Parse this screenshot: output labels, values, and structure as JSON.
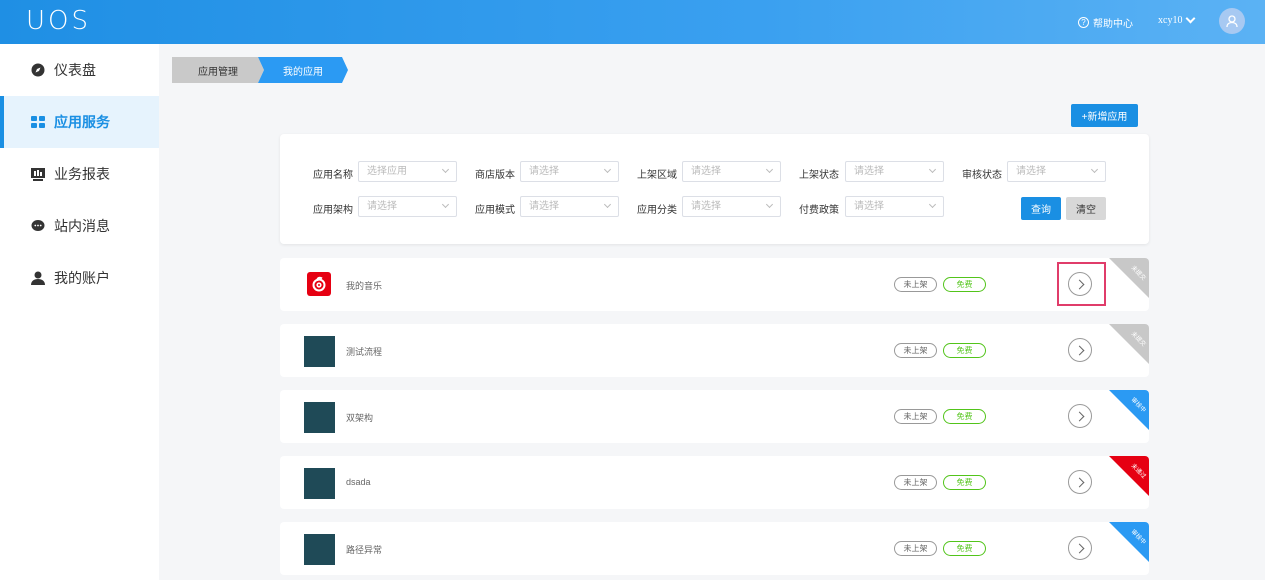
{
  "header": {
    "logo": "UOS",
    "help_label": "帮助中心",
    "username": "xcy10"
  },
  "sidebar": {
    "items": [
      {
        "label": "仪表盘",
        "icon": "compass-icon",
        "active": false
      },
      {
        "label": "应用服务",
        "icon": "grid-icon",
        "active": true
      },
      {
        "label": "业务报表",
        "icon": "report-icon",
        "active": false
      },
      {
        "label": "站内消息",
        "icon": "message-icon",
        "active": false
      },
      {
        "label": "我的账户",
        "icon": "user-icon",
        "active": false
      }
    ]
  },
  "breadcrumb": [
    "应用管理",
    "我的应用"
  ],
  "actions": {
    "add_app": "+新增应用"
  },
  "filters": {
    "app_name": {
      "label": "应用名称",
      "placeholder": "选择应用"
    },
    "store_version": {
      "label": "商店版本",
      "placeholder": "请选择"
    },
    "shelf_region": {
      "label": "上架区域",
      "placeholder": "请选择"
    },
    "shelf_status": {
      "label": "上架状态",
      "placeholder": "请选择"
    },
    "review_status": {
      "label": "审核状态",
      "placeholder": "请选择"
    },
    "app_arch": {
      "label": "应用架构",
      "placeholder": "请选择"
    },
    "app_mode": {
      "label": "应用模式",
      "placeholder": "请选择"
    },
    "app_category": {
      "label": "应用分类",
      "placeholder": "请选择"
    },
    "pay_policy": {
      "label": "付费政策",
      "placeholder": "请选择"
    },
    "query_label": "查询",
    "clear_label": "清空"
  },
  "apps": [
    {
      "name": "我的音乐",
      "shelf": "未上架",
      "price": "免费",
      "status": "未提交",
      "status_color": "#c8c8c8"
    },
    {
      "name": "测试流程",
      "shelf": "未上架",
      "price": "免费",
      "status": "未提交",
      "status_color": "#c8c8c8"
    },
    {
      "name": "双架构",
      "shelf": "未上架",
      "price": "免费",
      "status": "审核中",
      "status_color": "#2b9af3"
    },
    {
      "name": "dsada",
      "shelf": "未上架",
      "price": "免费",
      "status": "未通过",
      "status_color": "#e60012"
    },
    {
      "name": "路径异常",
      "shelf": "未上架",
      "price": "免费",
      "status": "审核中",
      "status_color": "#2b9af3"
    }
  ],
  "colors": {
    "primary": "#1a8fe3",
    "free_tag": "#52c41a",
    "focus_border": "#e03c6a"
  }
}
